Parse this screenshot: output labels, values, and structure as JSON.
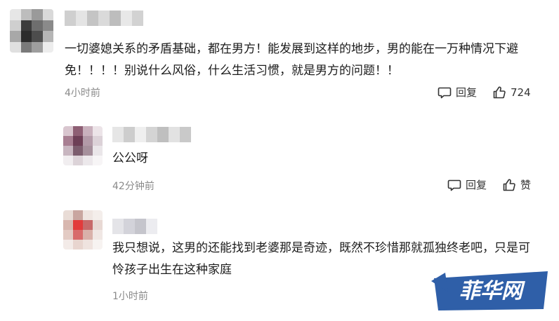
{
  "comments": [
    {
      "text": "一切婆媳关系的矛盾基础，都在男方！能发展到这样的地步，男的能在一万种情况下避免！！！！别说什么风俗，什么生活习惯，就是男方的问题！！",
      "time": "4小时前",
      "reply_label": "回复",
      "like_label": "724"
    },
    {
      "text": "公公呀",
      "time": "42分钟前",
      "reply_label": "回复",
      "like_label": "赞"
    },
    {
      "text": "我只想说，这男的还能找到老婆那是奇迹，既然不珍惜那就孤独终老吧，只是可怜孩子出生在这种家庭",
      "time": "1小时前"
    }
  ],
  "watermark": {
    "text": "菲华网",
    "color": "#2f5fa8"
  },
  "icons": {
    "reply": "comment-bubble-icon",
    "like": "thumbs-up-icon"
  }
}
